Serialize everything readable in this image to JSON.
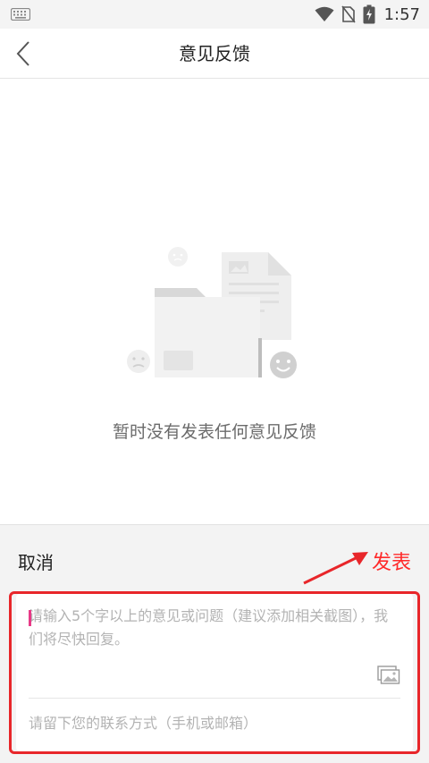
{
  "status_bar": {
    "time": "1:57",
    "icons": [
      "keyboard-icon",
      "wifi-icon",
      "no-sim-icon",
      "battery-charging-icon"
    ]
  },
  "header": {
    "title": "意见反馈",
    "back_icon": "chevron-left-icon"
  },
  "empty_state": {
    "illustration": "empty-folder-illustration",
    "message": "暂时没有发表任何意见反馈"
  },
  "compose": {
    "cancel_label": "取消",
    "publish_label": "发表",
    "feedback_placeholder": "请输入5个字以上的意见或问题（建议添加相关截图），我们将尽快回复。",
    "feedback_value": "",
    "image_icon": "image-icon",
    "contact_placeholder": "请留下您的联系方式（手机或邮箱）",
    "contact_value": ""
  },
  "colors": {
    "accent_red": "#ff2a2a",
    "annotation_red": "#e8262a",
    "caret_pink": "#e83a87",
    "panel_bg": "#f3f3f3"
  }
}
